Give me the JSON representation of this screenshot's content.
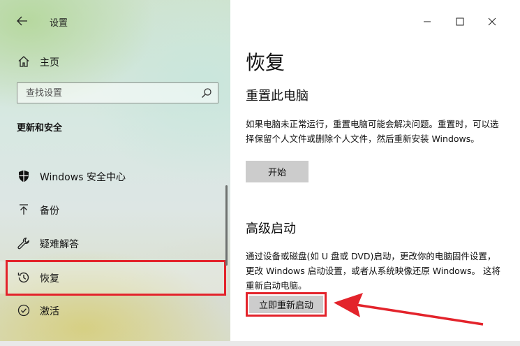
{
  "window": {
    "title": "设置",
    "controls": [
      "minimize-icon",
      "maximize-icon",
      "close-icon"
    ]
  },
  "sidebar": {
    "home_label": "主页",
    "search_placeholder": "查找设置",
    "section_heading": "更新和安全",
    "items": [
      {
        "label": "Windows 安全中心",
        "icon": "shield-icon"
      },
      {
        "label": "备份",
        "icon": "backup-arrow-icon"
      },
      {
        "label": "疑难解答",
        "icon": "wrench-icon"
      },
      {
        "label": "恢复",
        "icon": "history-icon",
        "active": true
      },
      {
        "label": "激活",
        "icon": "check-circle-icon"
      }
    ]
  },
  "main": {
    "page_title": "恢复",
    "reset": {
      "heading": "重置此电脑",
      "description": "如果电脑未正常运行，重置电脑可能会解决问题。重置时，可以选择保留个人文件或删除个人文件，然后重新安装 Windows。",
      "button_label": "开始"
    },
    "advanced": {
      "heading": "高级启动",
      "description": "通过设备或磁盘(如 U 盘或 DVD)启动，更改你的电脑固件设置，更改 Windows 启动设置，或者从系统映像还原 Windows。 这将重新启动电脑。",
      "button_label": "立即重新启动"
    }
  },
  "colors": {
    "highlight": "#e3232b",
    "button_bg": "#cccccc"
  }
}
